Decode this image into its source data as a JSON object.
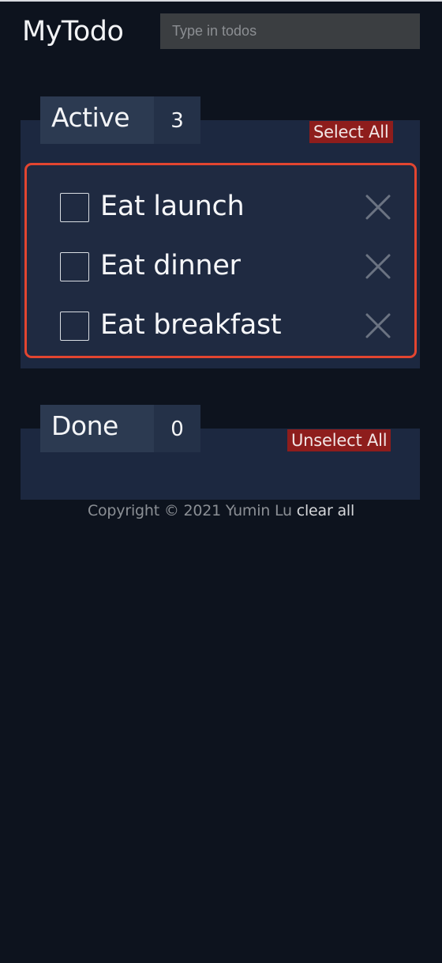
{
  "app": {
    "title": "MyTodo"
  },
  "search": {
    "placeholder": "Type in todos",
    "value": ""
  },
  "active": {
    "label": "Active",
    "count": "3",
    "bulk_action_label": "Select All",
    "items": [
      {
        "text": "Eat launch",
        "checked": false
      },
      {
        "text": "Eat dinner",
        "checked": false
      },
      {
        "text": "Eat breakfast",
        "checked": false
      }
    ]
  },
  "done": {
    "label": "Done",
    "count": "0",
    "bulk_action_label": "Unselect All",
    "items": []
  },
  "footer": {
    "copyright": "Copyright © 2021 Yumin Lu",
    "clear_all_label": "clear all"
  },
  "icons": {
    "delete": "close-x-icon",
    "checkbox": "checkbox-unchecked-icon"
  },
  "colors": {
    "background": "#0d131e",
    "panel": "#1c2840",
    "tab_label_bg": "#2c3a51",
    "bulk_button_bg": "#8e1d1c",
    "highlight_border": "#e24530"
  }
}
